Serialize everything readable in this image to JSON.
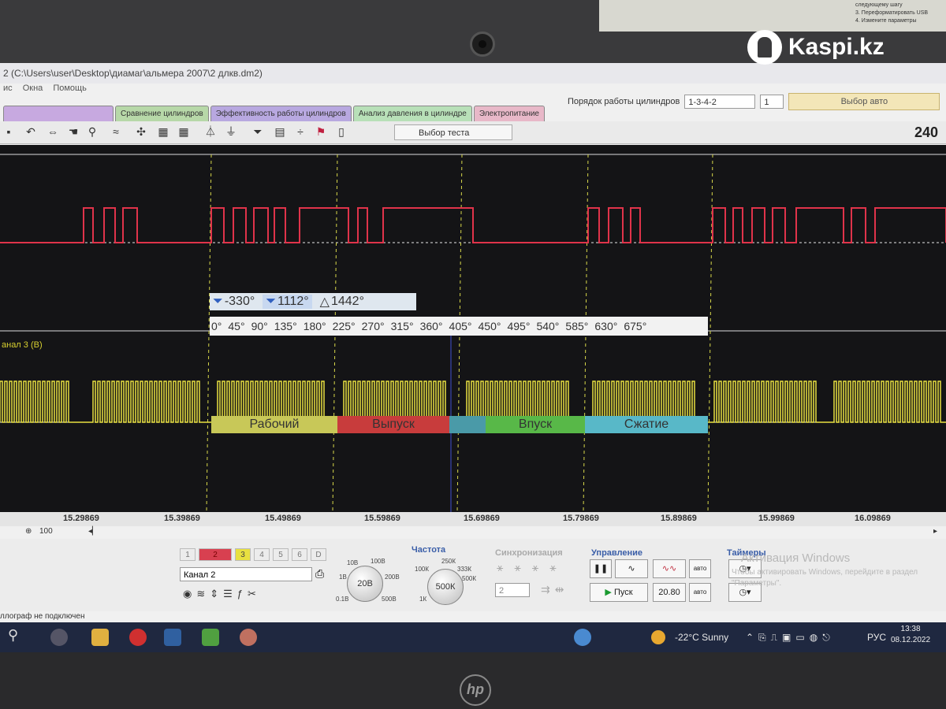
{
  "window": {
    "title": "2 (C:\\Users\\user\\Desktop\\диамаг\\альмера 2007\\2 длкв.dm2)",
    "menu": [
      "ис",
      "Окна",
      "Помощь"
    ],
    "firing_order_label": "Порядок работы цилиндров",
    "firing_order_value": "1-3-4-2",
    "cylinder_value": "1",
    "auto_select": "Выбор авто",
    "counter": "240"
  },
  "tabs": [
    {
      "label": "",
      "color": "#c7a9e0"
    },
    {
      "label": "Сравнение цилиндров",
      "color": "#b7d8a8"
    },
    {
      "label": "Эффективность работы цилиндров",
      "color": "#b8a8e0"
    },
    {
      "label": "Анализ давления в цилиндре",
      "color": "#b8e0b8"
    },
    {
      "label": "Электропитание",
      "color": "#e8b8c8"
    }
  ],
  "toolbar": {
    "test_select": "Выбор теста",
    "icons": [
      "save-icon",
      "undo-icon",
      "hand-icon",
      "zoom-icon",
      "wave-icon",
      "cross-icon",
      "grid-icon",
      "grid2-icon",
      "auto-icon",
      "zero-icon",
      "filter-icon",
      "table-icon",
      "split-icon",
      "flag-icon",
      "doc-icon"
    ]
  },
  "scope": {
    "channel3_label": "анал 3 (В)",
    "cursor1": "-330°",
    "cursor2": "1112°",
    "delta": "1442°",
    "angles": [
      "0°",
      "45°",
      "90°",
      "135°",
      "180°",
      "225°",
      "270°",
      "315°",
      "360°",
      "405°",
      "450°",
      "495°",
      "540°",
      "585°",
      "630°",
      "675°"
    ],
    "strokes": [
      {
        "label": "Рабочий",
        "color": "#c8c858"
      },
      {
        "label": "Выпуск",
        "color": "#c83c3c"
      },
      {
        "label": "",
        "color": "#4a9aa8"
      },
      {
        "label": "Впуск",
        "color": "#58b848"
      },
      {
        "label": "Сжатие",
        "color": "#58b8c8"
      }
    ],
    "time_ticks": [
      "15.29869",
      "15.39869",
      "15.49869",
      "15.59869",
      "15.69869",
      "15.79869",
      "15.89869",
      "15.99869",
      "16.09869"
    ],
    "zoom": "100",
    "colors": {
      "red": "#e0334a",
      "yellow": "#e8e040",
      "cursor": "#d8d84a"
    }
  },
  "panel": {
    "channels": [
      "1",
      "2",
      "3",
      "4",
      "5",
      "6",
      "D"
    ],
    "channel_select": "Канал 2",
    "voltage_knob": "20В",
    "voltage_labels": [
      "10В",
      "100В",
      "1В",
      "200В",
      "0.1В",
      "500В"
    ],
    "freq_title": "Частота",
    "freq_knob": "500К",
    "freq_labels": [
      "250К",
      "100К",
      "333К",
      "500К",
      "1К"
    ],
    "sync_title": "Синхронизация",
    "sync_value": "2",
    "control_title": "Управление",
    "start": "Пуск",
    "speed": "20.80",
    "auto1": "авто",
    "auto2": "авто",
    "timers_title": "Таймеры",
    "activation_title": "Активация Windows",
    "activation_text": "Чтобы активировать Windows, перейдите в раздел \"Параметры\".",
    "status": "ллограф не подключен"
  },
  "taskbar": {
    "weather": "-22°C  Sunny",
    "lang": "РУС",
    "time": "13:38",
    "date": "08.12.2022"
  },
  "overlay": {
    "watermark": "Kaspi.kz",
    "paper_lines": [
      "следующему шагу",
      "3. Переформатировать USB",
      "4. Измените параметры"
    ],
    "laptop_logo": "hp"
  }
}
